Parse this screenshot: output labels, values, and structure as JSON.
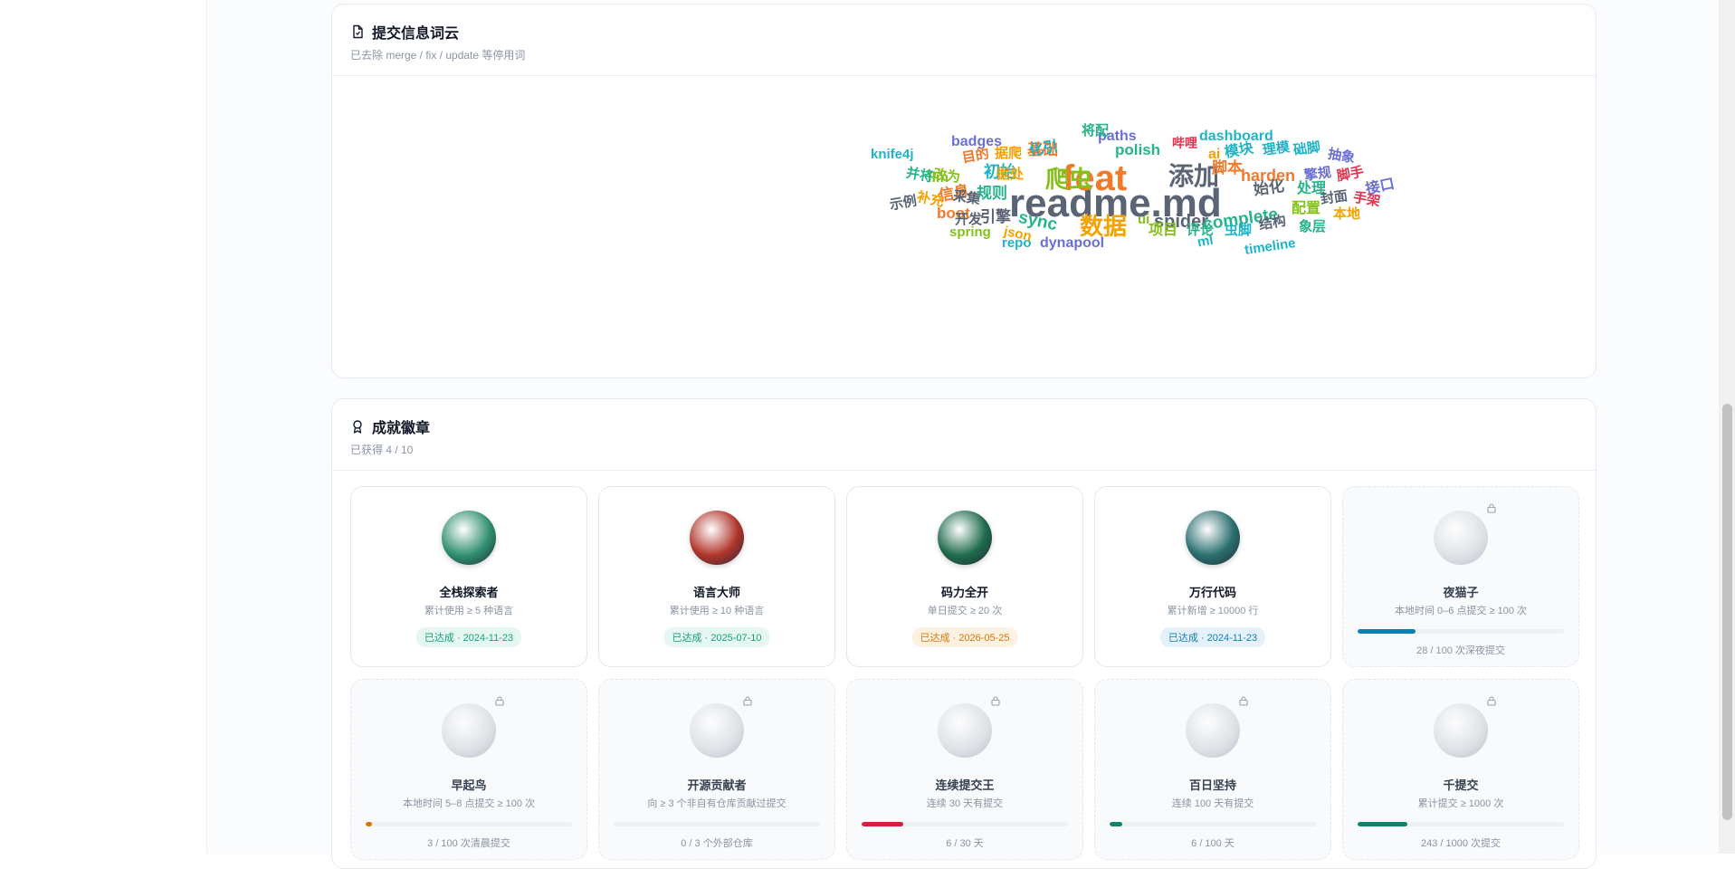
{
  "wordcloud": {
    "title": "提交信息词云",
    "subtitle": "已去除 merge / fix / update 等停用词",
    "words": [
      {
        "text": "readme.md",
        "color": "#5b6475",
        "size": 44,
        "rot": 0
      },
      {
        "text": "feat",
        "color": "#f07a2a",
        "size": 40,
        "rot": 0
      },
      {
        "text": "添加",
        "color": "#5b6475",
        "size": 28,
        "rot": 0
      },
      {
        "text": "爬虫",
        "color": "#84c21b",
        "size": 26,
        "rot": 0
      },
      {
        "text": "数据",
        "color": "#f5a200",
        "size": 26,
        "rot": 0
      },
      {
        "text": "spider",
        "color": "#5b6475",
        "size": 20,
        "rot": 0
      },
      {
        "text": "complete",
        "color": "#27b38b",
        "size": 19,
        "rot": -8
      },
      {
        "text": "sync",
        "color": "#27b38b",
        "size": 19,
        "rot": 12
      },
      {
        "text": "harden",
        "color": "#f07a2a",
        "size": 18,
        "rot": 0
      },
      {
        "text": "polish",
        "color": "#27b38b",
        "size": 17,
        "rot": 0
      },
      {
        "text": "boot",
        "color": "#f07a2a",
        "size": 17,
        "rot": 0
      },
      {
        "text": "dashboard",
        "color": "#1fb3c8",
        "size": 16,
        "rot": 0
      },
      {
        "text": "dynapool",
        "color": "#6b6fd4",
        "size": 16,
        "rot": 0
      },
      {
        "text": "paths",
        "color": "#6b6fd4",
        "size": 16,
        "rot": 0
      },
      {
        "text": "badges",
        "color": "#6b6fd4",
        "size": 16,
        "rot": 0
      },
      {
        "text": "knife4j",
        "color": "#1fb3c8",
        "size": 15,
        "rot": 0
      },
      {
        "text": "timeline",
        "color": "#1fb3c8",
        "size": 15,
        "rot": -8
      },
      {
        "text": "spring",
        "color": "#84c21b",
        "size": 15,
        "rot": 0
      },
      {
        "text": "repo",
        "color": "#1fb3c8",
        "size": 15,
        "rot": 0
      },
      {
        "text": "json",
        "color": "#f5a200",
        "size": 15,
        "rot": 12
      },
      {
        "text": "llm",
        "color": "#84c21b",
        "size": 16,
        "rot": 0
      },
      {
        "text": "ai",
        "color": "#f5a200",
        "size": 16,
        "rot": 0
      },
      {
        "text": "ui",
        "color": "#84c21b",
        "size": 15,
        "rot": 0
      },
      {
        "text": "ml",
        "color": "#1fb3c8",
        "size": 15,
        "rot": -10
      },
      {
        "text": "脚本",
        "color": "#f07a2a",
        "size": 17,
        "rot": 0
      },
      {
        "text": "基础",
        "color": "#f07a2a",
        "size": 17,
        "rot": 0
      },
      {
        "text": "规则",
        "color": "#27b38b",
        "size": 17,
        "rot": 0
      },
      {
        "text": "引擎",
        "color": "#5b6475",
        "size": 17,
        "rot": 0
      },
      {
        "text": "初始",
        "color": "#1fb3c8",
        "size": 18,
        "rot": 0
      },
      {
        "text": "信息",
        "color": "#f07a2a",
        "size": 17,
        "rot": -10
      },
      {
        "text": "处理",
        "color": "#27b38b",
        "size": 16,
        "rot": 0
      },
      {
        "text": "始化",
        "color": "#5b6475",
        "size": 17,
        "rot": -8
      },
      {
        "text": "配置",
        "color": "#84c21b",
        "size": 16,
        "rot": 0
      },
      {
        "text": "项目",
        "color": "#84c21b",
        "size": 16,
        "rot": 0
      },
      {
        "text": "评论",
        "color": "#27b38b",
        "size": 15,
        "rot": 0
      },
      {
        "text": "结构",
        "color": "#5b6475",
        "size": 15,
        "rot": -10
      },
      {
        "text": "象层",
        "color": "#27b38b",
        "size": 15,
        "rot": 0
      },
      {
        "text": "虫脚",
        "color": "#1fb3c8",
        "size": 15,
        "rot": 0
      },
      {
        "text": "模块",
        "color": "#1fb3c8",
        "size": 16,
        "rot": -10
      },
      {
        "text": "理模",
        "color": "#1fb3c8",
        "size": 15,
        "rot": -8
      },
      {
        "text": "础脚",
        "color": "#1fb3c8",
        "size": 15,
        "rot": -8
      },
      {
        "text": "抽象",
        "color": "#6b6fd4",
        "size": 15,
        "rot": 10
      },
      {
        "text": "擎规",
        "color": "#6b6fd4",
        "size": 15,
        "rot": -8
      },
      {
        "text": "脚手",
        "color": "#e0344f",
        "size": 15,
        "rot": -10
      },
      {
        "text": "接口",
        "color": "#6b6fd4",
        "size": 16,
        "rot": -12
      },
      {
        "text": "手架",
        "color": "#e0344f",
        "size": 15,
        "rot": 10
      },
      {
        "text": "封面",
        "color": "#5b6475",
        "size": 15,
        "rot": -8
      },
      {
        "text": "本地",
        "color": "#f5a200",
        "size": 15,
        "rot": 0
      },
      {
        "text": "哔哩",
        "color": "#e0344f",
        "size": 14,
        "rot": 0
      },
      {
        "text": "将配",
        "color": "#27b38b",
        "size": 15,
        "rot": 0
      },
      {
        "text": "化引",
        "color": "#1fb3c8",
        "size": 16,
        "rot": -10
      },
      {
        "text": "据爬",
        "color": "#f5a200",
        "size": 15,
        "rot": 0
      },
      {
        "text": "据处",
        "color": "#f5a200",
        "size": 15,
        "rot": 0
      },
      {
        "text": "目的",
        "color": "#f07a2a",
        "size": 15,
        "rot": -10
      },
      {
        "text": "改为",
        "color": "#84c21b",
        "size": 15,
        "rot": 8
      },
      {
        "text": "并将",
        "color": "#27b38b",
        "size": 15,
        "rot": 10
      },
      {
        "text": "补充",
        "color": "#f5a200",
        "size": 15,
        "rot": 12
      },
      {
        "text": "采集",
        "color": "#5b6475",
        "size": 15,
        "rot": 8
      },
      {
        "text": "示例",
        "color": "#5b6475",
        "size": 15,
        "rot": -10
      },
      {
        "text": "开发",
        "color": "#5b6475",
        "size": 15,
        "rot": 0
      }
    ]
  },
  "badges": {
    "title": "成就徽章",
    "subtitle": "已获得 4 / 10",
    "items": [
      {
        "name": "全栈探索者",
        "desc": "累计使用 ≥ 5 种语言",
        "unlocked": true,
        "status": "已达成 · 2024-11-23",
        "status_class": "status-teal",
        "medal_color": "#2f8f6f"
      },
      {
        "name": "语言大师",
        "desc": "累计使用 ≥ 10 种语言",
        "unlocked": true,
        "status": "已达成 · 2025-07-10",
        "status_class": "status-teal",
        "medal_color": "#b0342a"
      },
      {
        "name": "码力全开",
        "desc": "单日提交 ≥ 20 次",
        "unlocked": true,
        "status": "已达成 · 2026-05-25",
        "status_class": "status-orange",
        "medal_color": "#1e6b4c"
      },
      {
        "name": "万行代码",
        "desc": "累计新增 ≥ 10000 行",
        "unlocked": true,
        "status": "已达成 · 2024-11-23",
        "status_class": "status-blue",
        "medal_color": "#2a6e6e"
      },
      {
        "name": "夜猫子",
        "desc": "本地时间 0–6 点提交 ≥ 100 次",
        "unlocked": false,
        "progress_text": "28 / 100 次深夜提交",
        "progress": 0.28,
        "bar_color": "#0a7fb5"
      },
      {
        "name": "早起鸟",
        "desc": "本地时间 5–8 点提交 ≥ 100 次",
        "unlocked": false,
        "progress_text": "3 / 100 次清晨提交",
        "progress": 0.03,
        "bar_color": "#d97706"
      },
      {
        "name": "开源贡献者",
        "desc": "向 ≥ 3 个非自有仓库贡献过提交",
        "unlocked": false,
        "progress_text": "0 / 3 个外部仓库",
        "progress": 0,
        "bar_color": "#10a37f"
      },
      {
        "name": "连续提交王",
        "desc": "连续 30 天有提交",
        "unlocked": false,
        "progress_text": "6 / 30 天",
        "progress": 0.2,
        "bar_color": "#d0223f"
      },
      {
        "name": "百日坚持",
        "desc": "连续 100 天有提交",
        "unlocked": false,
        "progress_text": "6 / 100 天",
        "progress": 0.06,
        "bar_color": "#10846a"
      },
      {
        "name": "千提交",
        "desc": "累计提交 ≥ 1000 次",
        "unlocked": false,
        "progress_text": "243 / 1000 次提交",
        "progress": 0.243,
        "bar_color": "#10846a"
      }
    ]
  }
}
